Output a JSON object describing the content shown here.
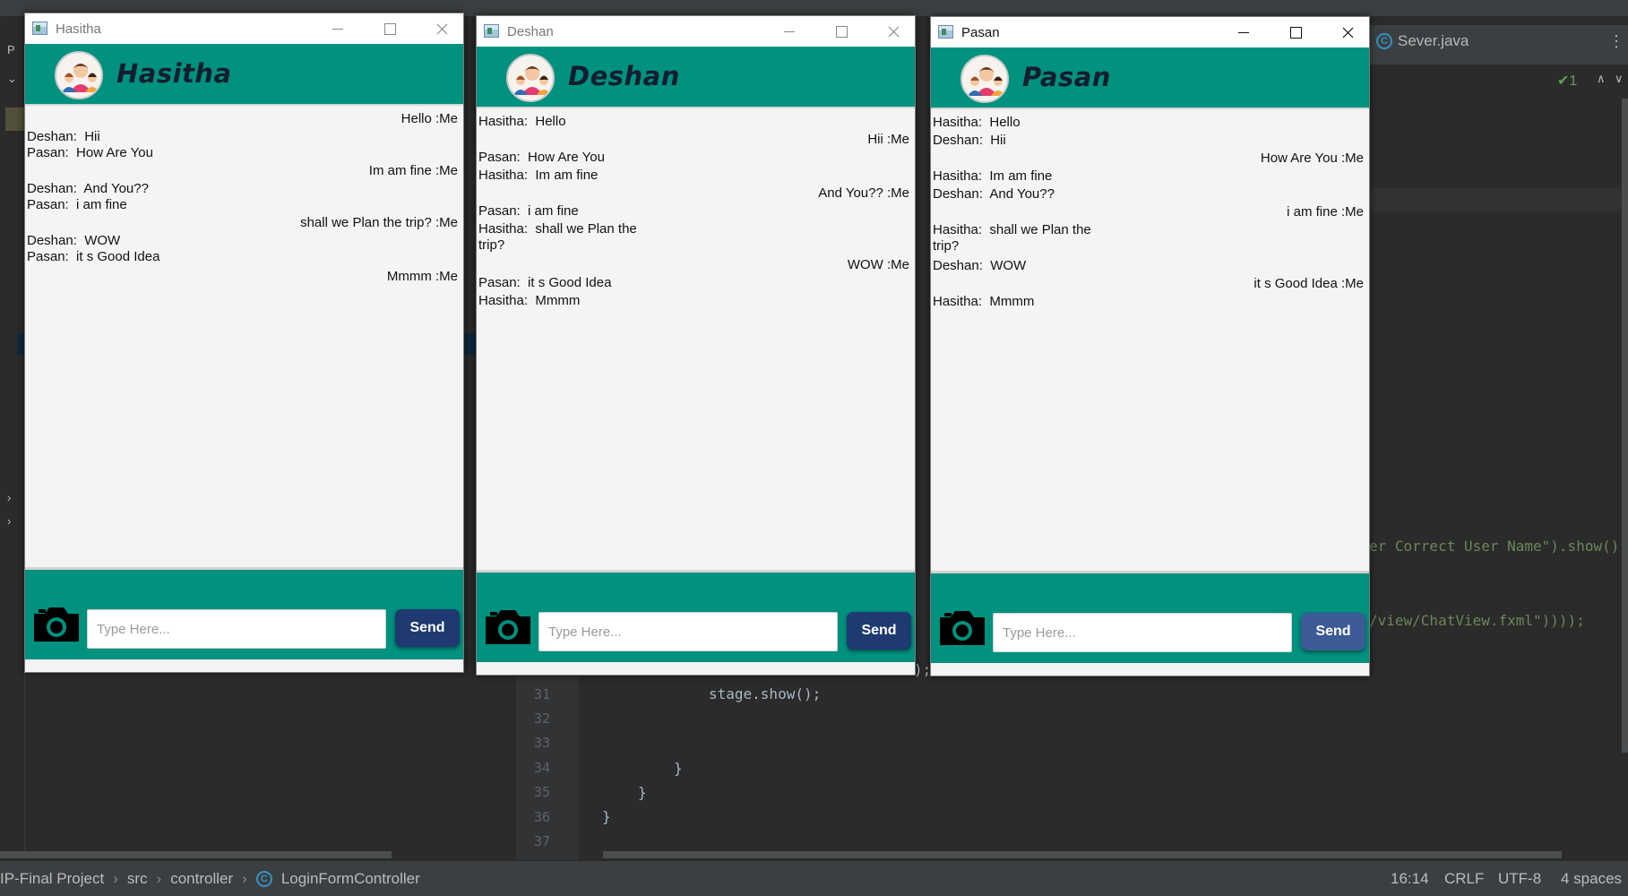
{
  "ide": {
    "tab_label": "Sever.java",
    "inspection_count": "1",
    "line_numbers": [
      "31",
      "32",
      "33",
      "34",
      "35",
      "36",
      "37"
    ],
    "code": {
      "line31": "stage.show();",
      "brace1": "}",
      "brace2": "}",
      "brace3": "}",
      "frag_error": "er Correct User Name\").show()",
      "frag_view": "/view/ChatView.fxml\"))));",
      "frag_paren": ");"
    },
    "breadcrumb": {
      "project": "IP-Final Project",
      "src": "src",
      "controller": "controller",
      "file": "LoginFormController"
    },
    "status": {
      "position": "16:14",
      "line_sep": "CRLF",
      "encoding": "UTF-8",
      "indent": "4 spaces"
    }
  },
  "chat_windows": [
    {
      "title": "Hasitha",
      "user": "Hasitha",
      "active": false,
      "placeholder": "Type Here...",
      "send_label": "Send",
      "messages": [
        {
          "text": "Hello :Me",
          "side": "right"
        },
        {
          "text": "Deshan:  Hii",
          "side": "left"
        },
        {
          "text": "Pasan:  How Are You",
          "side": "left"
        },
        {
          "text": "Im am fine :Me",
          "side": "right"
        },
        {
          "text": "Deshan:  And You??",
          "side": "left"
        },
        {
          "text": "Pasan:  i am fine",
          "side": "left"
        },
        {
          "text": "shall we Plan the trip? :Me",
          "side": "right"
        },
        {
          "text": "Deshan:  WOW",
          "side": "left"
        },
        {
          "text": "Pasan:  it s Good Idea",
          "side": "left"
        },
        {
          "text": "Mmmm :Me",
          "side": "right"
        }
      ]
    },
    {
      "title": "Deshan",
      "user": "Deshan",
      "active": false,
      "placeholder": "Type Here...",
      "send_label": "Send",
      "messages": [
        {
          "text": "Hasitha:  Hello",
          "side": "left"
        },
        {
          "text": "Hii :Me",
          "side": "right"
        },
        {
          "text": "Pasan:  How Are You",
          "side": "left"
        },
        {
          "text": "Hasitha:  Im am fine",
          "side": "left"
        },
        {
          "text": "And You?? :Me",
          "side": "right"
        },
        {
          "text": "Pasan:  i am fine",
          "side": "left"
        },
        {
          "text": "Hasitha:  shall we Plan the\ntrip?",
          "side": "left"
        },
        {
          "text": "WOW :Me",
          "side": "right"
        },
        {
          "text": "Pasan:  it s Good Idea",
          "side": "left"
        },
        {
          "text": "Hasitha:  Mmmm",
          "side": "left"
        }
      ]
    },
    {
      "title": "Pasan",
      "user": "Pasan",
      "active": true,
      "placeholder": "Type Here...",
      "send_label": "Send",
      "messages": [
        {
          "text": "Hasitha:  Hello",
          "side": "left"
        },
        {
          "text": "Deshan:  Hii",
          "side": "left"
        },
        {
          "text": "How Are You :Me",
          "side": "right"
        },
        {
          "text": "Hasitha:  Im am fine",
          "side": "left"
        },
        {
          "text": "Deshan:  And You??",
          "side": "left"
        },
        {
          "text": "i am fine :Me",
          "side": "right"
        },
        {
          "text": "Hasitha:  shall we Plan the\ntrip?",
          "side": "left"
        },
        {
          "text": "Deshan:  WOW",
          "side": "left"
        },
        {
          "text": "it s Good Idea :Me",
          "side": "right"
        },
        {
          "text": "Hasitha:  Mmmm",
          "side": "left"
        }
      ]
    }
  ],
  "colors": {
    "teal": "#00917f",
    "send_button": "#1e3a70",
    "ide_bg": "#2b2b2b"
  },
  "icons": [
    "camera-icon",
    "avatar-icon",
    "app-icon",
    "minimize-icon",
    "maximize-icon",
    "close-icon"
  ]
}
